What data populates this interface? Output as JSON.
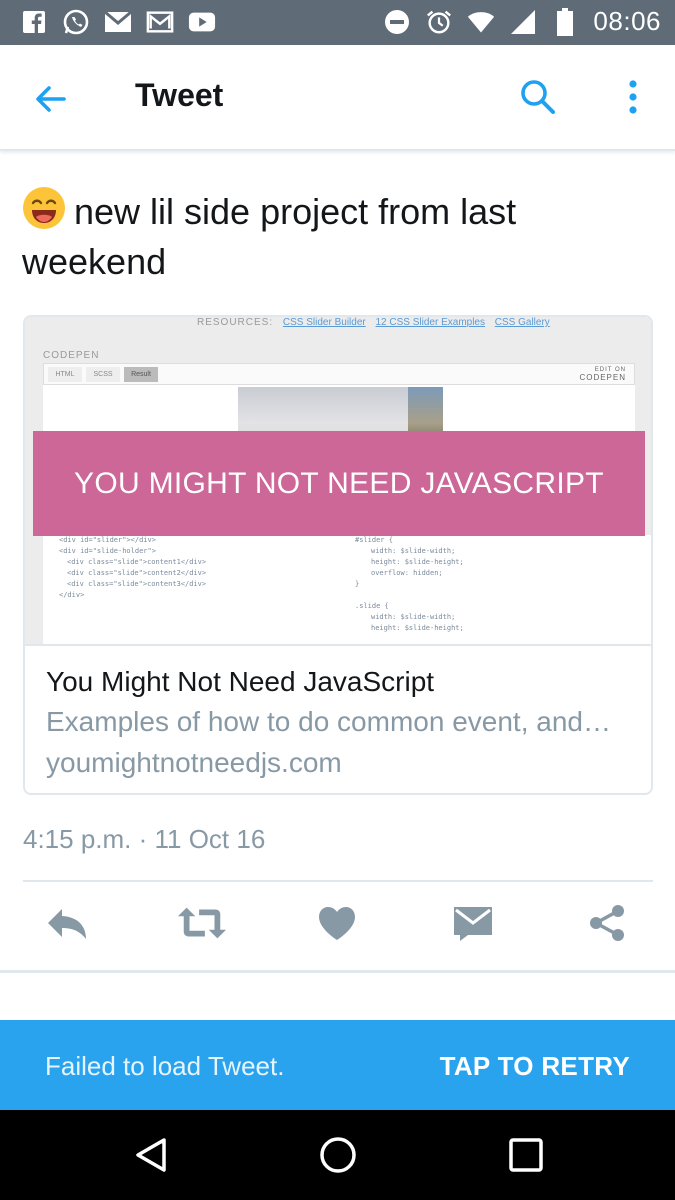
{
  "status_bar": {
    "time": "08:06",
    "left_icons": [
      "facebook-icon",
      "whatsapp-icon",
      "gmail-icon",
      "gmail-icon",
      "youtube-icon"
    ],
    "right_icons": [
      "do-not-disturb-icon",
      "alarm-icon",
      "wifi-icon",
      "signal-icon",
      "battery-icon"
    ]
  },
  "header": {
    "title": "Tweet",
    "back_icon": "arrow-left-icon",
    "search_icon": "search-icon",
    "more_icon": "more-vertical-icon"
  },
  "tweet": {
    "emoji": "smiling-face-icon",
    "text": "new lil side project from last weekend",
    "timestamp": "4:15 p.m. · 11 Oct 16"
  },
  "card": {
    "banner_text": "YOU MIGHT NOT NEED JAVASCRIPT",
    "title": "You Might Not Need JavaScript",
    "description": "Examples of how to do common event, and…",
    "domain": "youmightnotneedjs.com",
    "preview": {
      "resources_label": "RESOURCES:",
      "resource_links": [
        "CSS Slider Builder",
        "12 CSS Slider Examples",
        "CSS Gallery"
      ],
      "codepen_label": "CODEPEN",
      "tabs": [
        "HTML",
        "SCSS",
        "Result"
      ],
      "edit_on": "EDIT ON",
      "codepen_logo": "CODEPEN",
      "code_left": [
        "<div id=\"slider\"></div>",
        "<div id=\"slide-holder\">",
        "  <div class=\"slide\">content1</div>",
        "  <div class=\"slide\">content2</div>",
        "  <div class=\"slide\">content3</div>",
        "</div>"
      ],
      "code_right": [
        "#slider {",
        "    width: $slide-width;",
        "    height: $slide-height;",
        "    overflow: hidden;",
        "}",
        "",
        ".slide {",
        "    width: $slide-width;",
        "    height: $slide-height;"
      ]
    }
  },
  "actions": {
    "reply": "reply-icon",
    "retweet": "retweet-icon",
    "like": "heart-icon",
    "dm": "envelope-icon",
    "share": "share-icon"
  },
  "snackbar": {
    "message": "Failed to load Tweet.",
    "action": "TAP TO RETRY"
  },
  "nav": {
    "back": "nav-back-icon",
    "home": "nav-home-icon",
    "recents": "nav-recents-icon"
  },
  "colors": {
    "status_bar": "#5f6b76",
    "accent": "#1da1f2",
    "banner": "#cc6797",
    "snackbar": "#2aa3ef",
    "action_icon": "#8899a6"
  }
}
